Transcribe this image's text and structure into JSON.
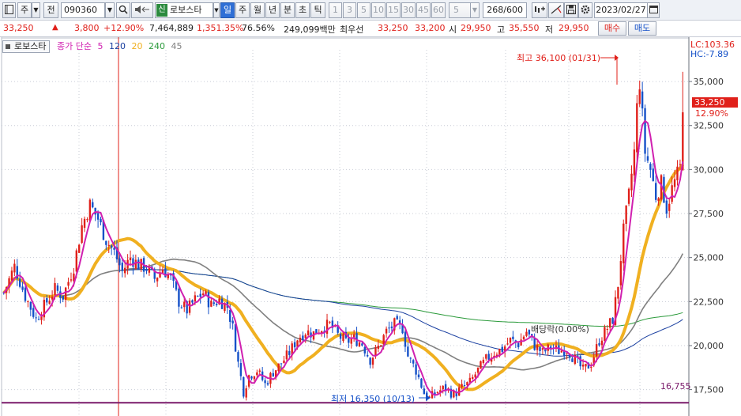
{
  "toolbar": {
    "period_type": "주",
    "jeon_label": "전",
    "stock_code": "090360",
    "market_badge": "신",
    "stock_name": "로보스타",
    "periods": [
      "일",
      "주",
      "월",
      "년",
      "분",
      "초",
      "틱"
    ],
    "active_period": "일",
    "minute_options": [
      "1",
      "3",
      "5",
      "10",
      "15",
      "30",
      "45",
      "60"
    ],
    "custom_interval": "5",
    "count_display": "268/600",
    "date": "2023/02/27"
  },
  "infobar": {
    "price": "33,250",
    "change_arrow": "▲",
    "change": "3,800",
    "change_pct": "+12.90%",
    "volume": "7,464,889",
    "volume_ratio": "1,351.35%",
    "turnover": "76.56%",
    "trade_value": "249,099백만",
    "best_ask_label": "최우선",
    "best_ask": "33,250",
    "best_bid": "33,200",
    "open_label": "시",
    "open": "29,950",
    "high_label": "고",
    "high": "35,550",
    "low_label": "저",
    "low": "29,950",
    "buy_label": "매수",
    "sell_label": "매도"
  },
  "legend": {
    "name": "로보스타",
    "indicator": "종가 단순",
    "ma_periods": [
      "5",
      "120",
      "20",
      "240",
      "45"
    ],
    "ma_colors": [
      "#d020b0",
      "#1a3fa0",
      "#f0b020",
      "#2a9a3a",
      "#808080"
    ]
  },
  "right_panel": {
    "lc_label": "LC:103.36",
    "hc_label": "HC:-7.89",
    "current_price": "33,250",
    "current_pct": "12.90%",
    "low_line_value": "16,755"
  },
  "annotations": {
    "high": "최고 36,100 (01/31)",
    "low": "최저 16,350 (10/13)",
    "dividend": "배당락(0.00%)"
  },
  "colors": {
    "up": "#e0201a",
    "down": "#1450c8",
    "ma5": "#d020b0",
    "ma20": "#f0b020",
    "ma45": "#808080",
    "ma120": "#1a3fa0",
    "ma240": "#2a9a3a",
    "low_line": "#7a1a6a"
  },
  "chart_data": {
    "type": "candlestick",
    "ylim": [
      16000,
      36800
    ],
    "y_ticks": [
      "17,500",
      "20,000",
      "22,500",
      "25,000",
      "27,500",
      "30,000",
      "32,500",
      "35,000"
    ],
    "y_tick_values": [
      17500,
      20000,
      22500,
      25000,
      27500,
      30000,
      32500,
      35000
    ],
    "trend_anchors": [
      [
        0,
        23000
      ],
      [
        4,
        24500
      ],
      [
        8,
        22800
      ],
      [
        12,
        21500
      ],
      [
        16,
        22500
      ],
      [
        19,
        23200
      ],
      [
        22,
        22800
      ],
      [
        26,
        24500
      ],
      [
        29,
        26800
      ],
      [
        32,
        28000
      ],
      [
        35,
        27200
      ],
      [
        38,
        26000
      ],
      [
        41,
        25300
      ],
      [
        44,
        24200
      ],
      [
        47,
        25000
      ],
      [
        50,
        24600
      ],
      [
        53,
        24400
      ],
      [
        56,
        23800
      ],
      [
        59,
        24400
      ],
      [
        62,
        23800
      ],
      [
        65,
        22500
      ],
      [
        68,
        22000
      ],
      [
        71,
        22600
      ],
      [
        74,
        23000
      ],
      [
        77,
        22300
      ],
      [
        80,
        22600
      ],
      [
        83,
        22200
      ],
      [
        85,
        21000
      ],
      [
        87,
        19000
      ],
      [
        89,
        17400
      ],
      [
        91,
        18300
      ],
      [
        94,
        18600
      ],
      [
        97,
        17800
      ],
      [
        100,
        18500
      ],
      [
        103,
        19000
      ],
      [
        106,
        19600
      ],
      [
        109,
        20400
      ],
      [
        112,
        20800
      ],
      [
        115,
        20700
      ],
      [
        118,
        21000
      ],
      [
        121,
        21200
      ],
      [
        124,
        20600
      ],
      [
        127,
        20200
      ],
      [
        130,
        20400
      ],
      [
        133,
        20100
      ],
      [
        136,
        19200
      ],
      [
        139,
        19900
      ],
      [
        142,
        20800
      ],
      [
        145,
        21200
      ],
      [
        148,
        21000
      ],
      [
        150,
        19400
      ],
      [
        153,
        18600
      ],
      [
        156,
        17300
      ],
      [
        158,
        17000
      ],
      [
        161,
        17400
      ],
      [
        164,
        17600
      ],
      [
        167,
        17200
      ],
      [
        170,
        17600
      ],
      [
        173,
        17900
      ],
      [
        176,
        18600
      ],
      [
        179,
        19200
      ],
      [
        182,
        19600
      ],
      [
        185,
        19800
      ],
      [
        188,
        20300
      ],
      [
        191,
        20100
      ],
      [
        194,
        20800
      ],
      [
        197,
        20000
      ],
      [
        200,
        19600
      ],
      [
        203,
        19900
      ],
      [
        206,
        19700
      ],
      [
        209,
        19800
      ],
      [
        212,
        19200
      ],
      [
        215,
        18600
      ],
      [
        218,
        19000
      ],
      [
        221,
        20300
      ],
      [
        224,
        21000
      ],
      [
        226,
        21500
      ],
      [
        228,
        23500
      ],
      [
        230,
        26500
      ],
      [
        232,
        28500
      ],
      [
        234,
        31000
      ],
      [
        235,
        33500
      ],
      [
        236,
        35000
      ],
      [
        237,
        33000
      ],
      [
        238,
        31000
      ],
      [
        240,
        30000
      ],
      [
        242,
        28500
      ],
      [
        244,
        29200
      ],
      [
        246,
        27800
      ],
      [
        248,
        28900
      ],
      [
        250,
        29700
      ],
      [
        251,
        30100
      ],
      [
        252,
        33250
      ]
    ]
  }
}
